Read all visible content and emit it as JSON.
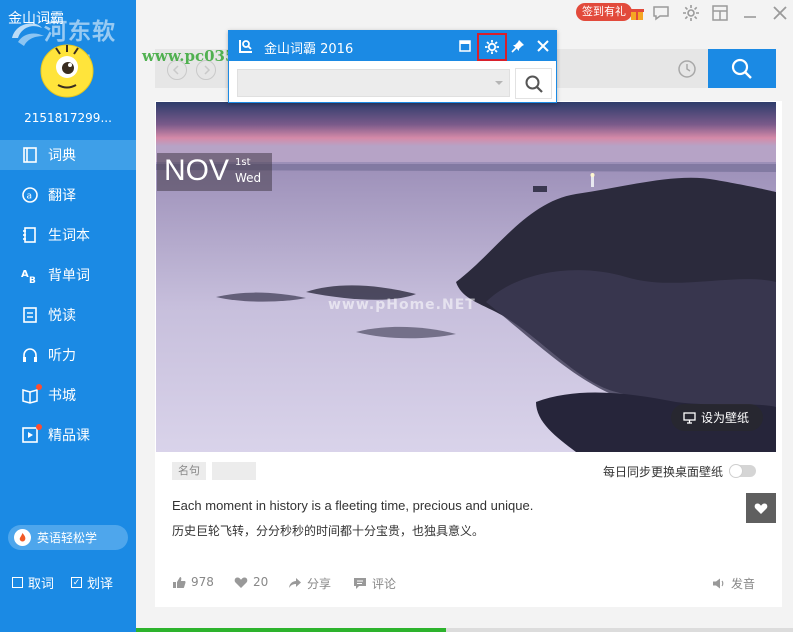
{
  "app": {
    "title": "金山词霸",
    "watermark_title": "河东软件园",
    "watermark_url": "www.pc0359.cn"
  },
  "user": {
    "name": "2151817299..."
  },
  "sidebar": {
    "items": [
      {
        "label": "词典",
        "icon": "dictionary-icon",
        "active": true
      },
      {
        "label": "翻译",
        "icon": "translate-icon"
      },
      {
        "label": "生词本",
        "icon": "vocabulary-book-icon"
      },
      {
        "label": "背单词",
        "icon": "memorize-words-icon"
      },
      {
        "label": "悦读",
        "icon": "reading-icon"
      },
      {
        "label": "听力",
        "icon": "headphones-icon"
      },
      {
        "label": "书城",
        "icon": "bookstore-icon"
      },
      {
        "label": "精品课",
        "icon": "course-play-icon"
      }
    ],
    "promo_label": "英语轻松学",
    "bottom": {
      "capture_label": "取词",
      "select_label": "划译"
    }
  },
  "topbar": {
    "signin_label": "签到有礼"
  },
  "mini_window": {
    "title": "金山词霸 2016"
  },
  "daily": {
    "month": "NOV",
    "day": "1st",
    "weekday": "Wed",
    "set_wallpaper_label": "设为壁纸",
    "hero_watermark": "www.pHome.NET",
    "tag_label": "名句",
    "sync_label": "每日同步更换桌面壁纸",
    "quote_en": "Each moment in history is a fleeting time, precious and unique.",
    "quote_cn": "历史巨轮飞转，分分秒秒的时间都十分宝贵，也独具意义。",
    "likes": "978",
    "favorites": "20",
    "share_label": "分享",
    "comment_label": "评论",
    "pronounce_label": "发音"
  },
  "colors": {
    "primary": "#1b8ae4",
    "sidebar_active": "#3e9fe8",
    "highlight_border": "#d8202c",
    "badge_red": "#e24a3b"
  }
}
